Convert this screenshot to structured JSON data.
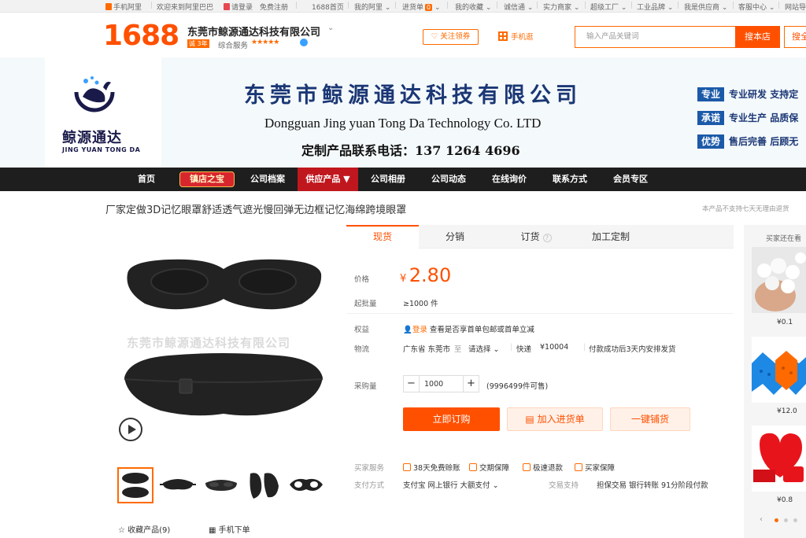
{
  "topbar": {
    "items": [
      "手机阿里",
      "欢迎来到阿里巴巴",
      "请登录",
      "免费注册",
      "1688首页",
      "我的阿里",
      "进货单",
      "我的收藏",
      "诚信通",
      "实力商家",
      "超级工厂",
      "工业品牌",
      "我是供应商",
      "客服中心",
      "网站导航"
    ],
    "cart_count": "0"
  },
  "header": {
    "logo": "1688",
    "company_name": "东莞市鲸源通达科技有限公司",
    "years_badge": "诚 3年",
    "service_label": "综合服务",
    "stars": "★★★★★",
    "follow_label": "关注领券",
    "mobile_label": "手机逛",
    "search_placeholder": "输入产品关键词",
    "search_store_label": "搜本店",
    "search_all_label": "搜全"
  },
  "banner": {
    "logo_cn": "鲸源通达",
    "logo_en": "JING YUAN TONG DA",
    "title_cn": "东莞市鲸源通达科技有限公司",
    "title_en": "Dongguan Jing yuan Tong Da Technology Co. LTD",
    "phone": "定制产品联系电话：137 1264 4696",
    "features": [
      {
        "tag": "专业",
        "text": "专业研发 支持定"
      },
      {
        "tag": "承诺",
        "text": "专业生产 品质保"
      },
      {
        "tag": "优势",
        "text": "售后完善 后顾无"
      }
    ]
  },
  "nav": {
    "items": [
      "首页",
      "镇店之宝",
      "公司档案",
      "供应产品 ▼",
      "公司相册",
      "公司动态",
      "在线询价",
      "联系方式",
      "会员专区"
    ]
  },
  "product": {
    "title": "厂家定做3D记忆眼罩舒适透气遮光慢回弹无边框记忆海绵跨境眼罩",
    "return_note": "本产品不支持七天无理由退货",
    "watermark": "东莞市鲸源通达科技有限公司",
    "favorite_label": "收藏产品(9)",
    "mobile_order_label": "手机下单"
  },
  "tabs": [
    "现货",
    "分销",
    "订货",
    "加工定制"
  ],
  "info": {
    "price_label": "价格",
    "currency": "¥",
    "price": "2.80",
    "moq_label": "起批量",
    "moq": "≥1000 件",
    "benefit_label": "权益",
    "login_link": "登录",
    "benefit_text": "查看是否享首单包邮或首单立减",
    "logistics_label": "物流",
    "origin": "广东省 东莞市",
    "to": "至",
    "dest": "请选择",
    "express": "快递",
    "express_price": "¥10004",
    "ship_note": "付款成功后3天内安排发货",
    "qty_label": "采购量",
    "qty_minus": "−",
    "qty_value": "1000",
    "qty_plus": "+",
    "stock": "(9996499件可售)",
    "buy_label": "立即订购",
    "cart_label": "加入进货单",
    "dist_label": "一键铺货",
    "buyer_service_label": "买家服务",
    "services": [
      "38天免费赊账",
      "交期保障",
      "极速退款",
      "买家保障"
    ],
    "payment_label": "支付方式",
    "payments": "支付宝   网上银行   大额支付",
    "trade_support_label": "交易支持",
    "trade_support": "担保交易   银行转账   91分阶段付款"
  },
  "rail": {
    "title": "买家还在看",
    "prices": [
      "¥0.1",
      "¥12.0",
      "¥0.8"
    ]
  },
  "colors": {
    "brand": "#ff5000",
    "nav_bg": "#1e1e1e",
    "nav_active": "#c0171e",
    "banner_blue": "#1b3775"
  }
}
